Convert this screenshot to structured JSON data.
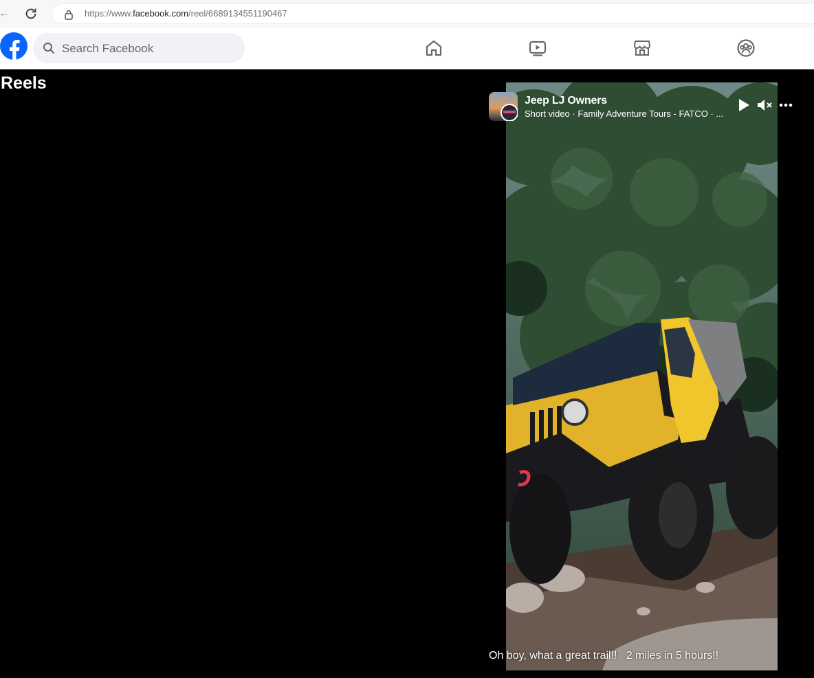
{
  "browser": {
    "url_scheme": "https://www.",
    "url_host": "facebook.com",
    "url_path": "/reel/6689134551190467"
  },
  "header": {
    "search_placeholder": "Search Facebook",
    "nav": [
      "home-icon",
      "video-icon",
      "marketplace-icon",
      "groups-icon"
    ],
    "brand_color": "#0866ff"
  },
  "page": {
    "title": "Reels"
  },
  "reel": {
    "author": "Jeep LJ Owners",
    "subtitle": "Short video · Family Adventure Tours - FATCO · ...",
    "caption": "Oh boy, what a great trail!!   2 miles in 5 hours!!",
    "controls": [
      "play-icon",
      "mute-icon",
      "more-icon"
    ]
  }
}
